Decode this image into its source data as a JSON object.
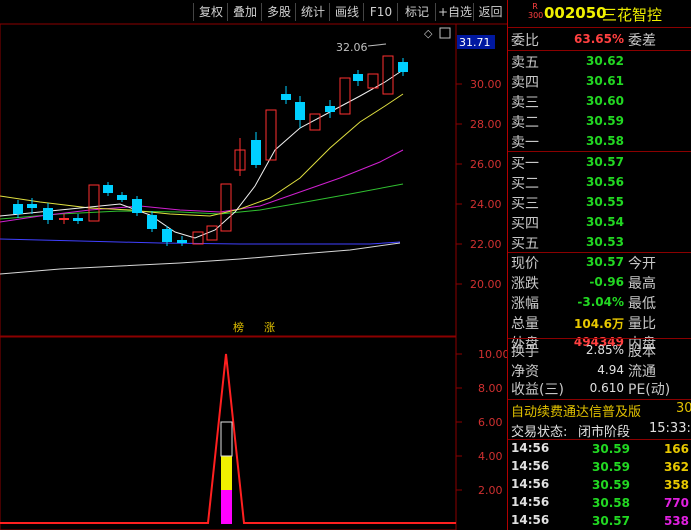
{
  "toolbar": {
    "buttons": [
      "复权",
      "叠加",
      "多股",
      "统计",
      "画线",
      "F10",
      "标记",
      "+自选",
      "返回"
    ]
  },
  "chart": {
    "price_axis": [
      "30.00",
      "28.00",
      "26.00",
      "24.00",
      "22.00",
      "20.00"
    ],
    "current_price_tag": "31.71",
    "high_annotation": "32.06",
    "indicator_axis": [
      "10.00",
      "8.00",
      "6.00",
      "4.00",
      "2.00"
    ],
    "mid_labels": [
      "榜",
      "涨"
    ],
    "corner_symbol": "◇"
  },
  "quote": {
    "badge_top": "R",
    "badge_bottom": "300",
    "code": "002050",
    "name": "三花智控",
    "weibi_label": "委比",
    "weibi_value": "63.65%",
    "weicha_label": "委差",
    "asks": [
      {
        "label": "卖五",
        "price": "30.62"
      },
      {
        "label": "卖四",
        "price": "30.61"
      },
      {
        "label": "卖三",
        "price": "30.60"
      },
      {
        "label": "卖二",
        "price": "30.59"
      },
      {
        "label": "卖一",
        "price": "30.58"
      }
    ],
    "bids": [
      {
        "label": "买一",
        "price": "30.57"
      },
      {
        "label": "买二",
        "price": "30.56"
      },
      {
        "label": "买三",
        "price": "30.55"
      },
      {
        "label": "买四",
        "price": "30.54"
      },
      {
        "label": "买五",
        "price": "30.53"
      }
    ],
    "stats": [
      {
        "label": "现价",
        "value": "30.57",
        "label2": "今开"
      },
      {
        "label": "涨跌",
        "value": "-0.96",
        "label2": "最高"
      },
      {
        "label": "涨幅",
        "value": "-3.04%",
        "label2": "最低"
      },
      {
        "label": "总量",
        "value": "104.6万",
        "label2": "量比"
      },
      {
        "label": "外盘",
        "value": "494349",
        "label2": "内盘"
      }
    ],
    "stats2": [
      {
        "label": "换手",
        "value": "2.85%",
        "label2": "股本"
      },
      {
        "label": "净资",
        "value": "4.94",
        "label2": "流通"
      },
      {
        "label": "收益(三)",
        "value": "0.610",
        "label2": "PE(动)"
      }
    ],
    "ticker": "自动续费通达信普及版",
    "ticker_num": "30",
    "trade_status_label": "交易状态:",
    "trade_status_value": "闭市阶段",
    "trade_status_time": "15:33:",
    "ticks": [
      {
        "time": "14:56",
        "price": "30.59",
        "vol": "166"
      },
      {
        "time": "14:56",
        "price": "30.59",
        "vol": "362"
      },
      {
        "time": "14:56",
        "price": "30.59",
        "vol": "358"
      },
      {
        "time": "14:56",
        "price": "30.58",
        "vol": "770"
      },
      {
        "time": "14:56",
        "price": "30.57",
        "vol": "538"
      }
    ]
  }
}
